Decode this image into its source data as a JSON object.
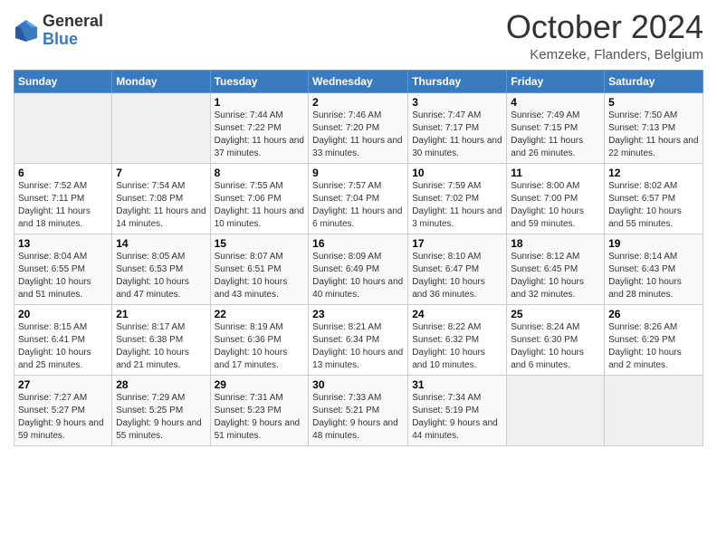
{
  "logo": {
    "general": "General",
    "blue": "Blue"
  },
  "title": "October 2024",
  "location": "Kemzeke, Flanders, Belgium",
  "headers": [
    "Sunday",
    "Monday",
    "Tuesday",
    "Wednesday",
    "Thursday",
    "Friday",
    "Saturday"
  ],
  "weeks": [
    [
      {
        "day": "",
        "sunrise": "",
        "sunset": "",
        "daylight": "",
        "empty": true
      },
      {
        "day": "",
        "sunrise": "",
        "sunset": "",
        "daylight": "",
        "empty": true
      },
      {
        "day": "1",
        "sunrise": "Sunrise: 7:44 AM",
        "sunset": "Sunset: 7:22 PM",
        "daylight": "Daylight: 11 hours and 37 minutes."
      },
      {
        "day": "2",
        "sunrise": "Sunrise: 7:46 AM",
        "sunset": "Sunset: 7:20 PM",
        "daylight": "Daylight: 11 hours and 33 minutes."
      },
      {
        "day": "3",
        "sunrise": "Sunrise: 7:47 AM",
        "sunset": "Sunset: 7:17 PM",
        "daylight": "Daylight: 11 hours and 30 minutes."
      },
      {
        "day": "4",
        "sunrise": "Sunrise: 7:49 AM",
        "sunset": "Sunset: 7:15 PM",
        "daylight": "Daylight: 11 hours and 26 minutes."
      },
      {
        "day": "5",
        "sunrise": "Sunrise: 7:50 AM",
        "sunset": "Sunset: 7:13 PM",
        "daylight": "Daylight: 11 hours and 22 minutes."
      }
    ],
    [
      {
        "day": "6",
        "sunrise": "Sunrise: 7:52 AM",
        "sunset": "Sunset: 7:11 PM",
        "daylight": "Daylight: 11 hours and 18 minutes."
      },
      {
        "day": "7",
        "sunrise": "Sunrise: 7:54 AM",
        "sunset": "Sunset: 7:08 PM",
        "daylight": "Daylight: 11 hours and 14 minutes."
      },
      {
        "day": "8",
        "sunrise": "Sunrise: 7:55 AM",
        "sunset": "Sunset: 7:06 PM",
        "daylight": "Daylight: 11 hours and 10 minutes."
      },
      {
        "day": "9",
        "sunrise": "Sunrise: 7:57 AM",
        "sunset": "Sunset: 7:04 PM",
        "daylight": "Daylight: 11 hours and 6 minutes."
      },
      {
        "day": "10",
        "sunrise": "Sunrise: 7:59 AM",
        "sunset": "Sunset: 7:02 PM",
        "daylight": "Daylight: 11 hours and 3 minutes."
      },
      {
        "day": "11",
        "sunrise": "Sunrise: 8:00 AM",
        "sunset": "Sunset: 7:00 PM",
        "daylight": "Daylight: 10 hours and 59 minutes."
      },
      {
        "day": "12",
        "sunrise": "Sunrise: 8:02 AM",
        "sunset": "Sunset: 6:57 PM",
        "daylight": "Daylight: 10 hours and 55 minutes."
      }
    ],
    [
      {
        "day": "13",
        "sunrise": "Sunrise: 8:04 AM",
        "sunset": "Sunset: 6:55 PM",
        "daylight": "Daylight: 10 hours and 51 minutes."
      },
      {
        "day": "14",
        "sunrise": "Sunrise: 8:05 AM",
        "sunset": "Sunset: 6:53 PM",
        "daylight": "Daylight: 10 hours and 47 minutes."
      },
      {
        "day": "15",
        "sunrise": "Sunrise: 8:07 AM",
        "sunset": "Sunset: 6:51 PM",
        "daylight": "Daylight: 10 hours and 43 minutes."
      },
      {
        "day": "16",
        "sunrise": "Sunrise: 8:09 AM",
        "sunset": "Sunset: 6:49 PM",
        "daylight": "Daylight: 10 hours and 40 minutes."
      },
      {
        "day": "17",
        "sunrise": "Sunrise: 8:10 AM",
        "sunset": "Sunset: 6:47 PM",
        "daylight": "Daylight: 10 hours and 36 minutes."
      },
      {
        "day": "18",
        "sunrise": "Sunrise: 8:12 AM",
        "sunset": "Sunset: 6:45 PM",
        "daylight": "Daylight: 10 hours and 32 minutes."
      },
      {
        "day": "19",
        "sunrise": "Sunrise: 8:14 AM",
        "sunset": "Sunset: 6:43 PM",
        "daylight": "Daylight: 10 hours and 28 minutes."
      }
    ],
    [
      {
        "day": "20",
        "sunrise": "Sunrise: 8:15 AM",
        "sunset": "Sunset: 6:41 PM",
        "daylight": "Daylight: 10 hours and 25 minutes."
      },
      {
        "day": "21",
        "sunrise": "Sunrise: 8:17 AM",
        "sunset": "Sunset: 6:38 PM",
        "daylight": "Daylight: 10 hours and 21 minutes."
      },
      {
        "day": "22",
        "sunrise": "Sunrise: 8:19 AM",
        "sunset": "Sunset: 6:36 PM",
        "daylight": "Daylight: 10 hours and 17 minutes."
      },
      {
        "day": "23",
        "sunrise": "Sunrise: 8:21 AM",
        "sunset": "Sunset: 6:34 PM",
        "daylight": "Daylight: 10 hours and 13 minutes."
      },
      {
        "day": "24",
        "sunrise": "Sunrise: 8:22 AM",
        "sunset": "Sunset: 6:32 PM",
        "daylight": "Daylight: 10 hours and 10 minutes."
      },
      {
        "day": "25",
        "sunrise": "Sunrise: 8:24 AM",
        "sunset": "Sunset: 6:30 PM",
        "daylight": "Daylight: 10 hours and 6 minutes."
      },
      {
        "day": "26",
        "sunrise": "Sunrise: 8:26 AM",
        "sunset": "Sunset: 6:29 PM",
        "daylight": "Daylight: 10 hours and 2 minutes."
      }
    ],
    [
      {
        "day": "27",
        "sunrise": "Sunrise: 7:27 AM",
        "sunset": "Sunset: 5:27 PM",
        "daylight": "Daylight: 9 hours and 59 minutes."
      },
      {
        "day": "28",
        "sunrise": "Sunrise: 7:29 AM",
        "sunset": "Sunset: 5:25 PM",
        "daylight": "Daylight: 9 hours and 55 minutes."
      },
      {
        "day": "29",
        "sunrise": "Sunrise: 7:31 AM",
        "sunset": "Sunset: 5:23 PM",
        "daylight": "Daylight: 9 hours and 51 minutes."
      },
      {
        "day": "30",
        "sunrise": "Sunrise: 7:33 AM",
        "sunset": "Sunset: 5:21 PM",
        "daylight": "Daylight: 9 hours and 48 minutes."
      },
      {
        "day": "31",
        "sunrise": "Sunrise: 7:34 AM",
        "sunset": "Sunset: 5:19 PM",
        "daylight": "Daylight: 9 hours and 44 minutes."
      },
      {
        "day": "",
        "sunrise": "",
        "sunset": "",
        "daylight": "",
        "empty": true
      },
      {
        "day": "",
        "sunrise": "",
        "sunset": "",
        "daylight": "",
        "empty": true
      }
    ]
  ]
}
